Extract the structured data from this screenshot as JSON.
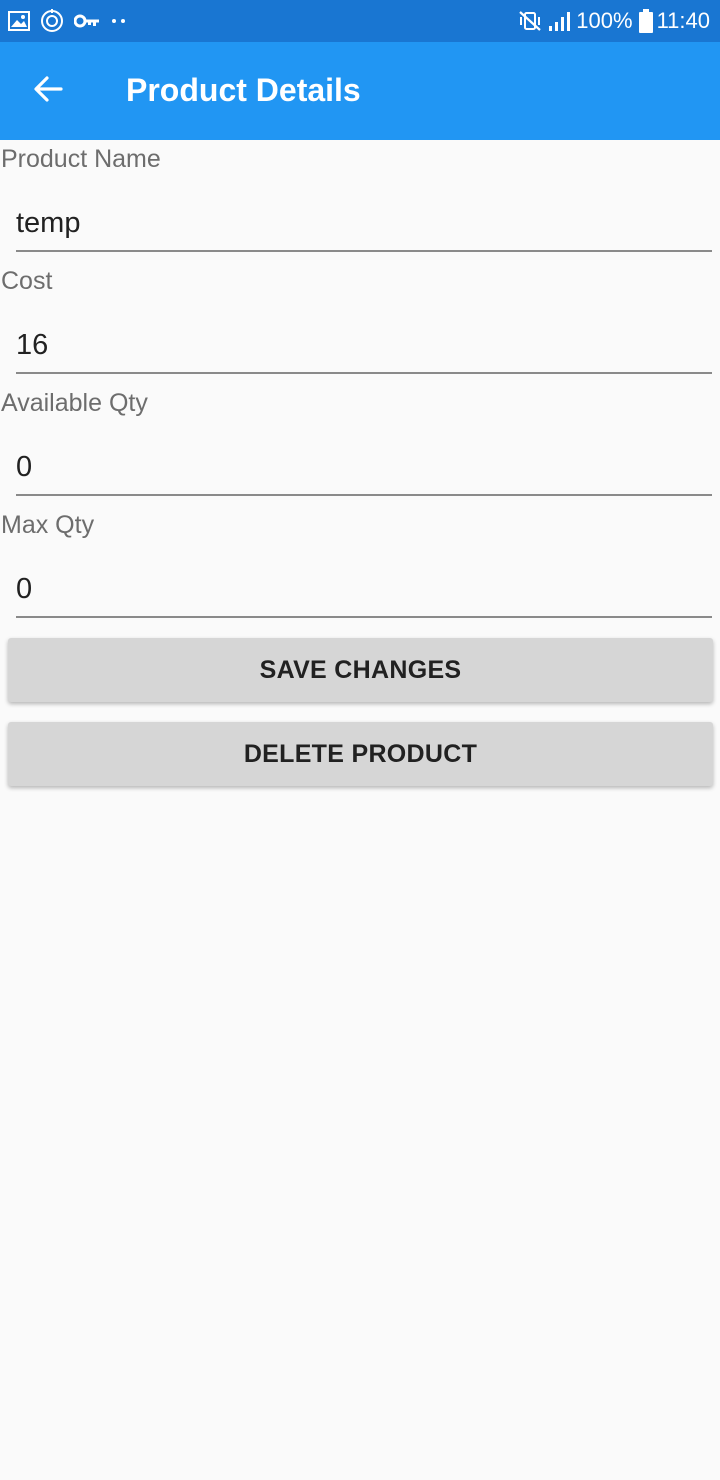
{
  "status_bar": {
    "icons_left": [
      "gallery-icon",
      "location-target-icon",
      "key-icon",
      "more-dots-icon"
    ],
    "icons_right": [
      "vibrate-mute-icon",
      "signal-icon",
      "battery-icon"
    ],
    "battery": "100%",
    "time": "11:40"
  },
  "app_bar": {
    "title": "Product Details",
    "back_icon": "arrow-back-icon",
    "background": "#2196f3"
  },
  "form": {
    "product_name": {
      "label": "Product Name",
      "value": "temp"
    },
    "cost": {
      "label": "Cost",
      "value": "16"
    },
    "available_qty": {
      "label": "Available Qty",
      "value": "0"
    },
    "max_qty": {
      "label": "Max Qty",
      "value": "0"
    }
  },
  "actions": {
    "save_label": "SAVE CHANGES",
    "delete_label": "DELETE PRODUCT"
  }
}
